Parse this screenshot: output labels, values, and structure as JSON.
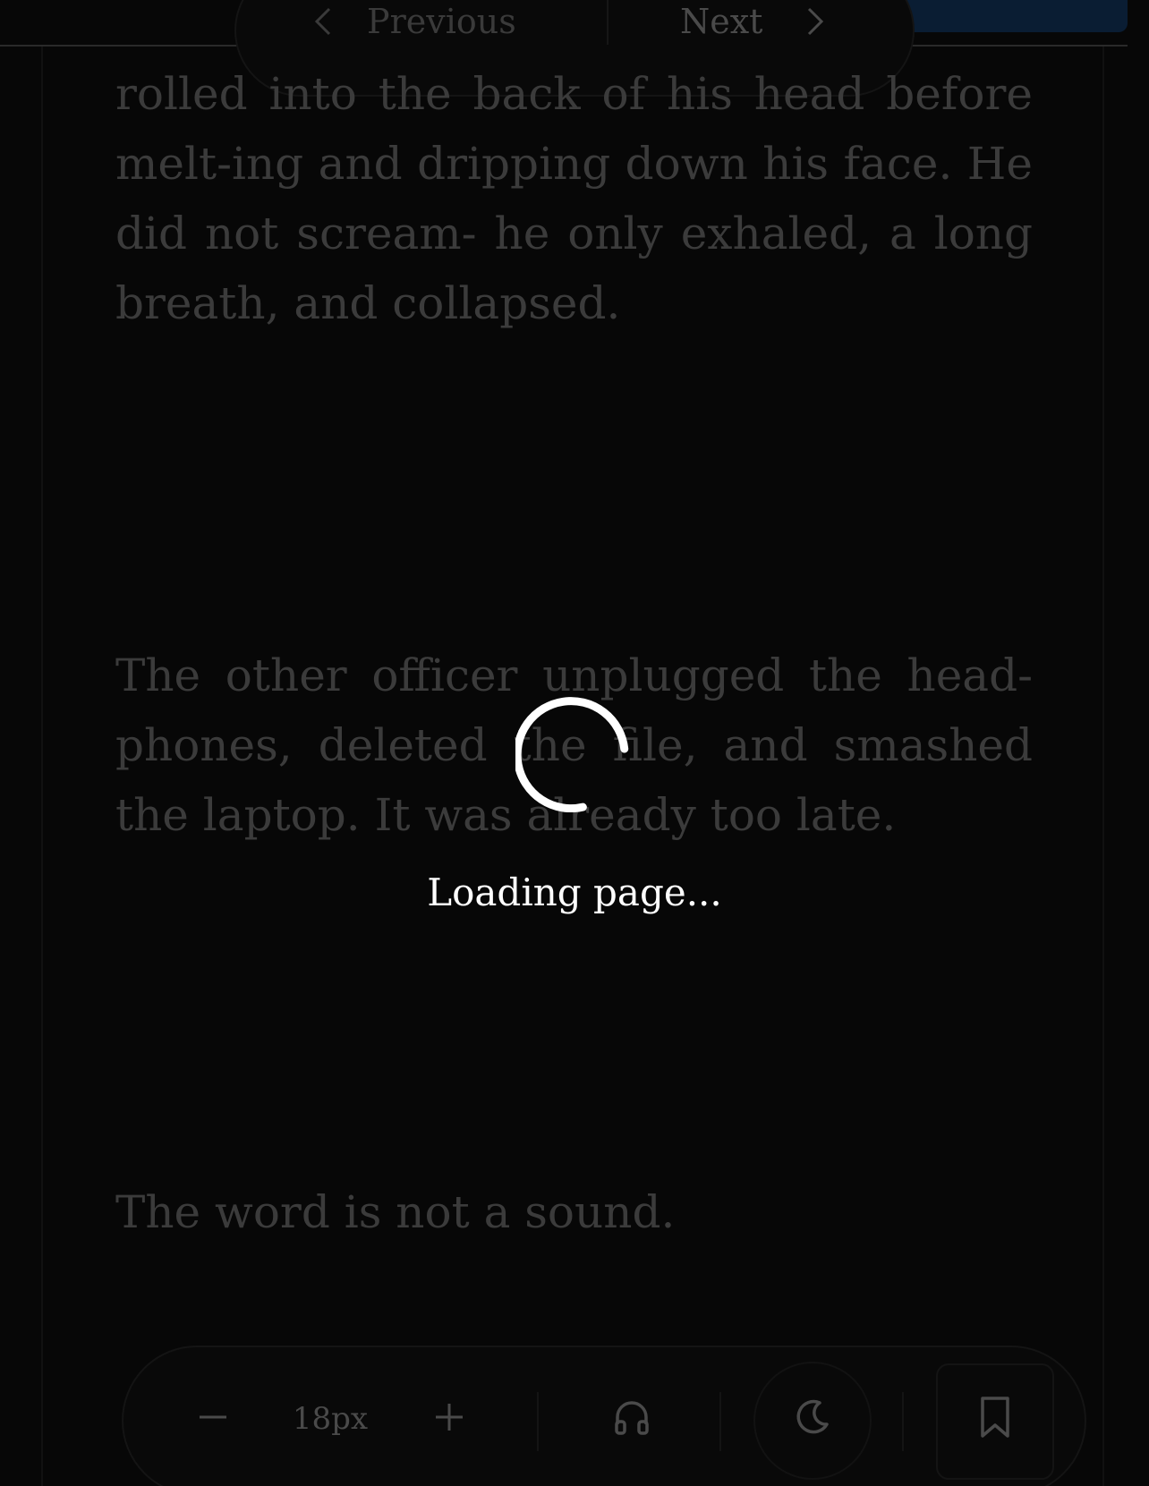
{
  "navigation": {
    "previous_label": "Previous",
    "next_label": "Next"
  },
  "content": {
    "paragraphs": [
      "rolled into the back of his head before melt-ing and dripping down his face.  He did not scream- he only exhaled, a long breath, and collapsed.",
      "The other officer unplugged the head-phones, deleted the file, and smashed the laptop. It was already too late.",
      "The word is not a sound."
    ]
  },
  "loading": {
    "text": "Loading page..."
  },
  "toolbar": {
    "font_size_value": "18px",
    "icons": {
      "decrease": "minus-icon",
      "increase": "plus-icon",
      "audio": "headphones-icon",
      "theme": "moon-icon",
      "bookmark": "bookmark-icon"
    }
  },
  "colors": {
    "background": "#070707",
    "dimmed_text": "#3b3b3b",
    "loading_text": "#ffffff",
    "accent": "#0a1d33"
  }
}
